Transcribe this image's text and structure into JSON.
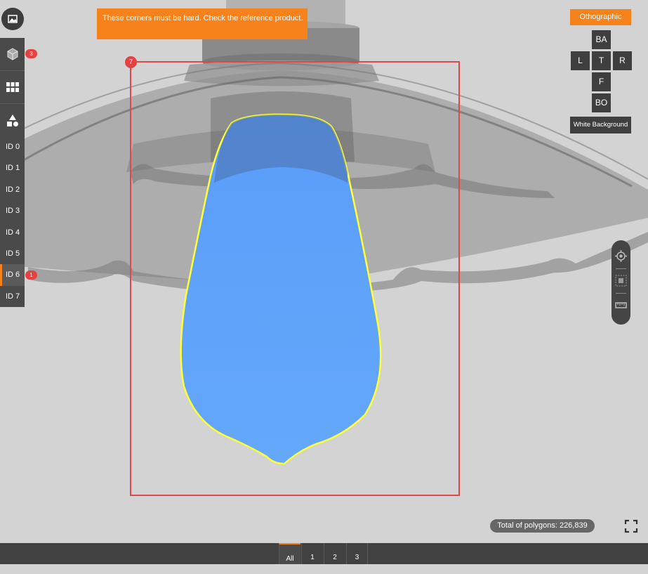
{
  "toolbar": {
    "top_icon": "image-icon",
    "items": [
      {
        "icon": "cube-mesh-icon",
        "badge": "3"
      },
      {
        "icon": "grid-icon",
        "badge": ""
      },
      {
        "icon": "shapes-icon",
        "badge": ""
      }
    ]
  },
  "ids": [
    {
      "label": "ID 0",
      "active": false,
      "badge": ""
    },
    {
      "label": "ID 1",
      "active": false,
      "badge": ""
    },
    {
      "label": "ID 2",
      "active": false,
      "badge": ""
    },
    {
      "label": "ID 3",
      "active": false,
      "badge": ""
    },
    {
      "label": "ID 4",
      "active": false,
      "badge": ""
    },
    {
      "label": "ID 5",
      "active": false,
      "badge": ""
    },
    {
      "label": "ID 6",
      "active": true,
      "badge": "1"
    },
    {
      "label": "ID 7",
      "active": false,
      "badge": ""
    }
  ],
  "annotation": {
    "text": "These corners must be hard. Check the reference product.",
    "number": "7"
  },
  "view": {
    "mode_label": "Othographic",
    "buttons": {
      "ba": "BA",
      "l": "L",
      "t": "T",
      "r": "R",
      "f": "F",
      "bo": "BO"
    },
    "white_background": "White Background"
  },
  "tools": [
    "target-icon",
    "select-area-icon",
    "ruler-icon"
  ],
  "status": {
    "polygons": "Total of polygons: 226,839"
  },
  "bottom_tabs": [
    "All",
    "1",
    "2",
    "3"
  ],
  "colors": {
    "accent": "#f7821b",
    "alert": "#e74040",
    "highlight": "#ffff33",
    "selection": "#5aa3fb"
  }
}
